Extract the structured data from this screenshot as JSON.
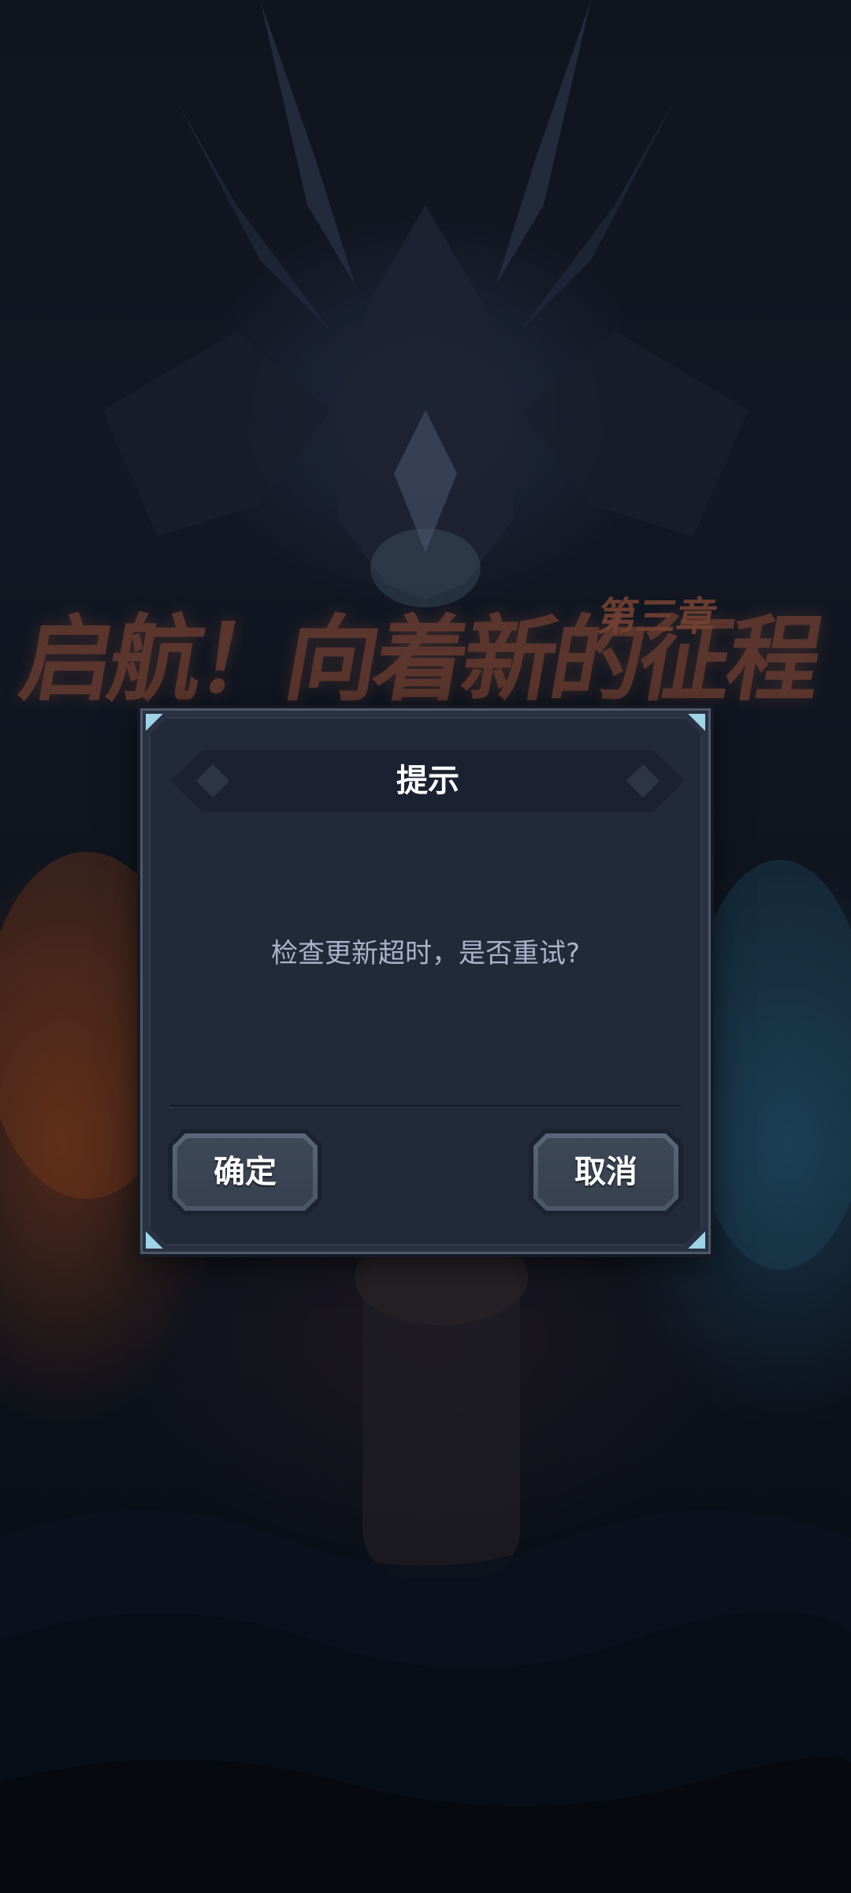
{
  "background": {
    "chapter_title": "启航！向着新的征程",
    "chapter_label": "第三章"
  },
  "dialog": {
    "title": "提示",
    "message": "检查更新超时，是否重试?",
    "confirm_label": "确定",
    "cancel_label": "取消"
  },
  "colors": {
    "dialog_bg": "#222938",
    "title_bar": "#1b2130",
    "corner_accent": "#9fd3e8",
    "button_face": "#3d4857",
    "message_text": "#aab3c8"
  },
  "icons": {
    "corner": "corner-accent-icon",
    "title_ornament": "diamond-ornament-icon"
  }
}
